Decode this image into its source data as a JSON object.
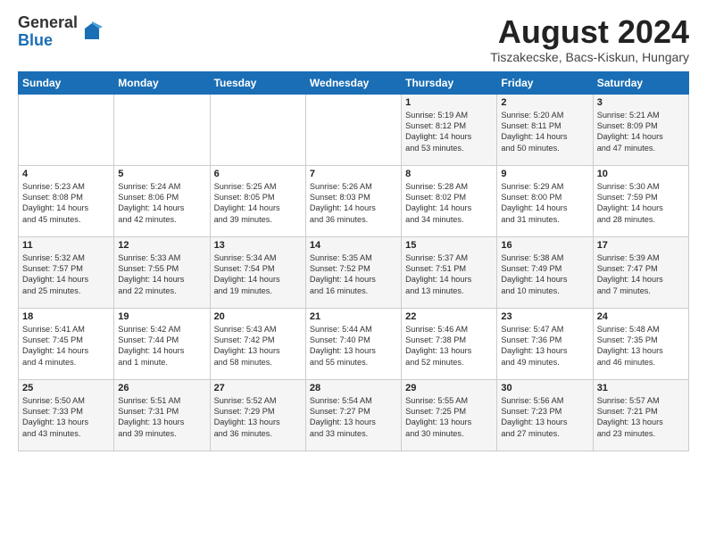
{
  "logo": {
    "general": "General",
    "blue": "Blue"
  },
  "header": {
    "month": "August 2024",
    "location": "Tiszakecske, Bacs-Kiskun, Hungary"
  },
  "weekdays": [
    "Sunday",
    "Monday",
    "Tuesday",
    "Wednesday",
    "Thursday",
    "Friday",
    "Saturday"
  ],
  "weeks": [
    [
      {
        "day": "",
        "text": ""
      },
      {
        "day": "",
        "text": ""
      },
      {
        "day": "",
        "text": ""
      },
      {
        "day": "",
        "text": ""
      },
      {
        "day": "1",
        "text": "Sunrise: 5:19 AM\nSunset: 8:12 PM\nDaylight: 14 hours\nand 53 minutes."
      },
      {
        "day": "2",
        "text": "Sunrise: 5:20 AM\nSunset: 8:11 PM\nDaylight: 14 hours\nand 50 minutes."
      },
      {
        "day": "3",
        "text": "Sunrise: 5:21 AM\nSunset: 8:09 PM\nDaylight: 14 hours\nand 47 minutes."
      }
    ],
    [
      {
        "day": "4",
        "text": "Sunrise: 5:23 AM\nSunset: 8:08 PM\nDaylight: 14 hours\nand 45 minutes."
      },
      {
        "day": "5",
        "text": "Sunrise: 5:24 AM\nSunset: 8:06 PM\nDaylight: 14 hours\nand 42 minutes."
      },
      {
        "day": "6",
        "text": "Sunrise: 5:25 AM\nSunset: 8:05 PM\nDaylight: 14 hours\nand 39 minutes."
      },
      {
        "day": "7",
        "text": "Sunrise: 5:26 AM\nSunset: 8:03 PM\nDaylight: 14 hours\nand 36 minutes."
      },
      {
        "day": "8",
        "text": "Sunrise: 5:28 AM\nSunset: 8:02 PM\nDaylight: 14 hours\nand 34 minutes."
      },
      {
        "day": "9",
        "text": "Sunrise: 5:29 AM\nSunset: 8:00 PM\nDaylight: 14 hours\nand 31 minutes."
      },
      {
        "day": "10",
        "text": "Sunrise: 5:30 AM\nSunset: 7:59 PM\nDaylight: 14 hours\nand 28 minutes."
      }
    ],
    [
      {
        "day": "11",
        "text": "Sunrise: 5:32 AM\nSunset: 7:57 PM\nDaylight: 14 hours\nand 25 minutes."
      },
      {
        "day": "12",
        "text": "Sunrise: 5:33 AM\nSunset: 7:55 PM\nDaylight: 14 hours\nand 22 minutes."
      },
      {
        "day": "13",
        "text": "Sunrise: 5:34 AM\nSunset: 7:54 PM\nDaylight: 14 hours\nand 19 minutes."
      },
      {
        "day": "14",
        "text": "Sunrise: 5:35 AM\nSunset: 7:52 PM\nDaylight: 14 hours\nand 16 minutes."
      },
      {
        "day": "15",
        "text": "Sunrise: 5:37 AM\nSunset: 7:51 PM\nDaylight: 14 hours\nand 13 minutes."
      },
      {
        "day": "16",
        "text": "Sunrise: 5:38 AM\nSunset: 7:49 PM\nDaylight: 14 hours\nand 10 minutes."
      },
      {
        "day": "17",
        "text": "Sunrise: 5:39 AM\nSunset: 7:47 PM\nDaylight: 14 hours\nand 7 minutes."
      }
    ],
    [
      {
        "day": "18",
        "text": "Sunrise: 5:41 AM\nSunset: 7:45 PM\nDaylight: 14 hours\nand 4 minutes."
      },
      {
        "day": "19",
        "text": "Sunrise: 5:42 AM\nSunset: 7:44 PM\nDaylight: 14 hours\nand 1 minute."
      },
      {
        "day": "20",
        "text": "Sunrise: 5:43 AM\nSunset: 7:42 PM\nDaylight: 13 hours\nand 58 minutes."
      },
      {
        "day": "21",
        "text": "Sunrise: 5:44 AM\nSunset: 7:40 PM\nDaylight: 13 hours\nand 55 minutes."
      },
      {
        "day": "22",
        "text": "Sunrise: 5:46 AM\nSunset: 7:38 PM\nDaylight: 13 hours\nand 52 minutes."
      },
      {
        "day": "23",
        "text": "Sunrise: 5:47 AM\nSunset: 7:36 PM\nDaylight: 13 hours\nand 49 minutes."
      },
      {
        "day": "24",
        "text": "Sunrise: 5:48 AM\nSunset: 7:35 PM\nDaylight: 13 hours\nand 46 minutes."
      }
    ],
    [
      {
        "day": "25",
        "text": "Sunrise: 5:50 AM\nSunset: 7:33 PM\nDaylight: 13 hours\nand 43 minutes."
      },
      {
        "day": "26",
        "text": "Sunrise: 5:51 AM\nSunset: 7:31 PM\nDaylight: 13 hours\nand 39 minutes."
      },
      {
        "day": "27",
        "text": "Sunrise: 5:52 AM\nSunset: 7:29 PM\nDaylight: 13 hours\nand 36 minutes."
      },
      {
        "day": "28",
        "text": "Sunrise: 5:54 AM\nSunset: 7:27 PM\nDaylight: 13 hours\nand 33 minutes."
      },
      {
        "day": "29",
        "text": "Sunrise: 5:55 AM\nSunset: 7:25 PM\nDaylight: 13 hours\nand 30 minutes."
      },
      {
        "day": "30",
        "text": "Sunrise: 5:56 AM\nSunset: 7:23 PM\nDaylight: 13 hours\nand 27 minutes."
      },
      {
        "day": "31",
        "text": "Sunrise: 5:57 AM\nSunset: 7:21 PM\nDaylight: 13 hours\nand 23 minutes."
      }
    ]
  ]
}
